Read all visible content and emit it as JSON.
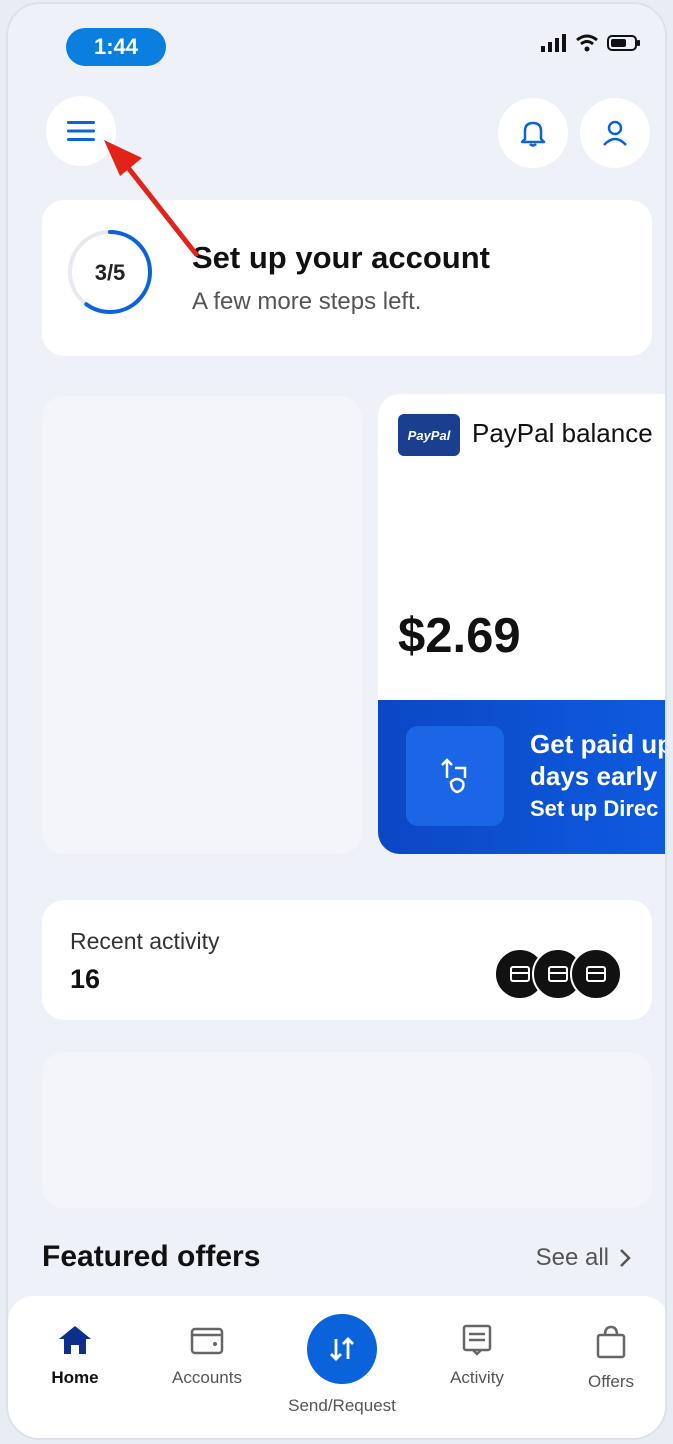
{
  "status_bar": {
    "time": "1:44"
  },
  "account_setup": {
    "progress_label": "3/5",
    "progress_fraction": 0.6,
    "title": "Set up your account",
    "subtitle": "A few more steps left."
  },
  "balance_card": {
    "logo_text": "PayPal",
    "title": "PayPal balance",
    "amount": "$2.69",
    "promo_line1": "Get paid up",
    "promo_line2": "days early",
    "promo_line3": "Set up Direc"
  },
  "recent_activity": {
    "label": "Recent activity",
    "count": "16"
  },
  "featured_offers": {
    "title": "Featured offers",
    "see_all": "See all"
  },
  "tabs": [
    {
      "label": "Home",
      "icon": "home-icon",
      "active": true
    },
    {
      "label": "Accounts",
      "icon": "wallet-icon"
    },
    {
      "label": "Send/Request",
      "icon": "send-request-icon"
    },
    {
      "label": "Activity",
      "icon": "receipt-icon"
    },
    {
      "label": "Offers",
      "icon": "shopping-bag-icon"
    }
  ],
  "colors": {
    "accent": "#0b63dc",
    "promo_blue": "#0b47c4",
    "time_pill": "#0a7fe0"
  },
  "annotation": {
    "type": "red-arrow",
    "points_to": "menu-button"
  }
}
